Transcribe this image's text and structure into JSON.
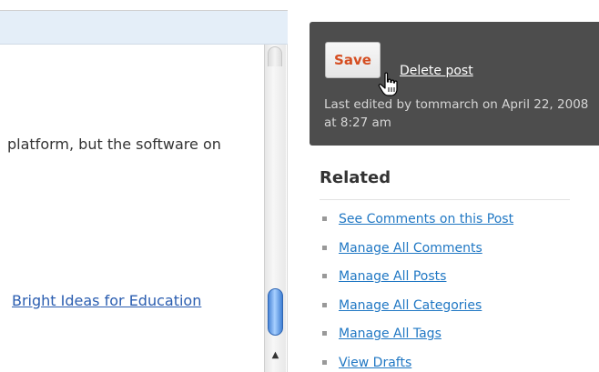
{
  "editor": {
    "visible_text": "platform, but the software on",
    "link_text": "Bright Ideas for Education"
  },
  "publish": {
    "save_label": "Save",
    "delete_label": "Delete post",
    "last_edited": "Last edited by tommarch on April 22, 2008 at 8:27 am"
  },
  "related": {
    "title": "Related",
    "items": [
      {
        "label": "See Comments on this Post"
      },
      {
        "label": "Manage All Comments"
      },
      {
        "label": "Manage All Posts"
      },
      {
        "label": "Manage All Categories"
      },
      {
        "label": "Manage All Tags"
      },
      {
        "label": "View Drafts"
      }
    ]
  },
  "colors": {
    "publish_box_bg": "#4d4d4d",
    "save_text": "#d54e21",
    "link": "#2178c4",
    "scroll_thumb": "#4a86d8"
  },
  "icons": {
    "cursor": "hand-pointer-icon",
    "scroll_up": "scroll-up-arrow-icon"
  }
}
